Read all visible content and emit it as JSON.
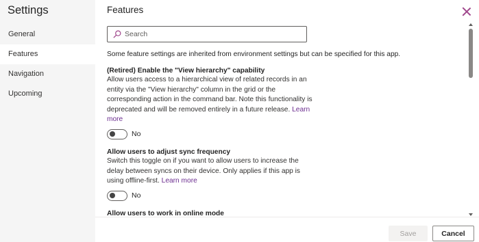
{
  "sidebar": {
    "title": "Settings",
    "items": [
      {
        "label": "General",
        "active": false
      },
      {
        "label": "Features",
        "active": true
      },
      {
        "label": "Navigation",
        "active": false
      },
      {
        "label": "Upcoming",
        "active": false
      }
    ]
  },
  "main": {
    "title": "Features",
    "search": {
      "placeholder": "Search",
      "value": ""
    },
    "intro": "Some feature settings are inherited from environment settings but can be specified for this app.",
    "features": [
      {
        "title": "(Retired) Enable the \"View hierarchy\" capability",
        "description": "Allow users access to a hierarchical view of related records in an entity via the \"View hierarchy\" column in the grid or the corresponding action in the command bar. Note this functionality is deprecated and will be removed entirely in a future release.",
        "link": "Learn more",
        "toggle_state": "No"
      },
      {
        "title": "Allow users to adjust sync frequency",
        "description": "Switch this toggle on if you want to allow users to increase the delay between syncs on their device. Only applies if this app is using offline-first.",
        "link": "Learn more",
        "toggle_state": "No"
      },
      {
        "title": "Allow users to work in online mode"
      }
    ]
  },
  "footer": {
    "save_label": "Save",
    "cancel_label": "Cancel"
  },
  "colors": {
    "accent": "#a0478c",
    "link": "#6b2d8f",
    "sidebar_bg": "#f5f5f5"
  },
  "icons": {
    "search": "search-icon",
    "close": "close-icon"
  }
}
